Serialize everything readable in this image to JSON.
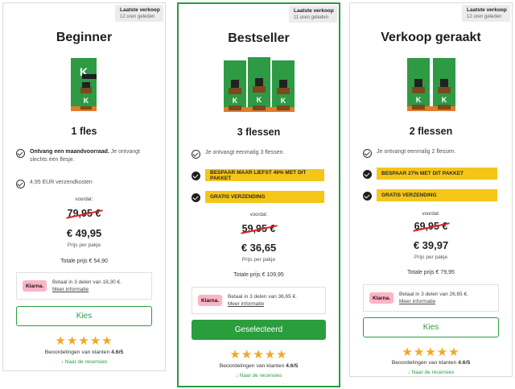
{
  "colors": {
    "accent_green": "#2a9d3d",
    "highlight_yellow": "#f5c518",
    "star_orange": "#f5a623",
    "strike_red": "#dd2222",
    "klarna_pink": "#ffb3c7"
  },
  "cards": [
    {
      "badge_title": "Laatste verkoop",
      "badge_sub": "12 uren geleden",
      "title": "Beginner",
      "bottles": 1,
      "quantity": "1 fles",
      "feature_bold": "Ontvang een maandvoorraad.",
      "feature_text": " Je ontvangt slechts één flesje.",
      "feature_shipping": "4,95 EUR verzendkosten",
      "voordat": "voordat:",
      "old_price": "79,95 €",
      "price": "€ 49,95",
      "per_pack": "Prijs per pakje",
      "total": "Totale prijs € 54,90",
      "klarna_logo": "Klarna.",
      "klarna_text": "Betaal in 3 delen van 18,30 €.",
      "klarna_link": "Meer informatie",
      "button": "Kies",
      "stars": "★★★★★",
      "rating_label": "Beoordelingen van klanten ",
      "rating_value": "4.6/5",
      "reviews_link": "↓ Naar de recensies"
    },
    {
      "badge_title": "Laatste verkoop",
      "badge_sub": "11 uren geleden",
      "title": "Bestseller",
      "bottles": 3,
      "quantity": "3 flessen",
      "feature_text": "Je ontvangt eenmalig 3 flessen.",
      "highlight_1": "BESPAAR MAAR LIEFST 46% MET DIT PAKKET",
      "highlight_2": "GRATIS VERZENDING",
      "voordat": "voordat:",
      "old_price": "59,95 €",
      "price": "€ 36,65",
      "per_pack": "Prijs per pakje",
      "total": "Totale prijs € 109,95",
      "klarna_logo": "Klarna.",
      "klarna_text": "Betaal in 3 delen van 36,65 €.",
      "klarna_link": "Meer informatie",
      "button": "Geselecteerd",
      "stars": "★★★★★",
      "rating_label": "Beoordelingen van klanten ",
      "rating_value": "4.6/5",
      "reviews_link": "↓ Naar de recensies"
    },
    {
      "badge_title": "Laatste verkoop",
      "badge_sub": "12 uren geleden",
      "title": "Verkoop geraakt",
      "bottles": 2,
      "quantity": "2 flessen",
      "feature_text": "Je ontvangt eenmalig 2 flessen.",
      "highlight_1": "BESPAAR 27% MET DIT PAKKET",
      "highlight_2": "GRATIS VERZENDING",
      "voordat": "voordat:",
      "old_price": "69,95 €",
      "price": "€ 39,97",
      "per_pack": "Prijs per pakje",
      "total": "Totale prijs € 79,95",
      "klarna_logo": "Klarna.",
      "klarna_text": "Betaal in 3 delen van 26,65 €.",
      "klarna_link": "Meer informatie",
      "button": "Kies",
      "stars": "★★★★★",
      "rating_label": "Beoordelingen van klanten ",
      "rating_value": "4.6/5",
      "reviews_link": "↓ Naar de recensies"
    }
  ]
}
